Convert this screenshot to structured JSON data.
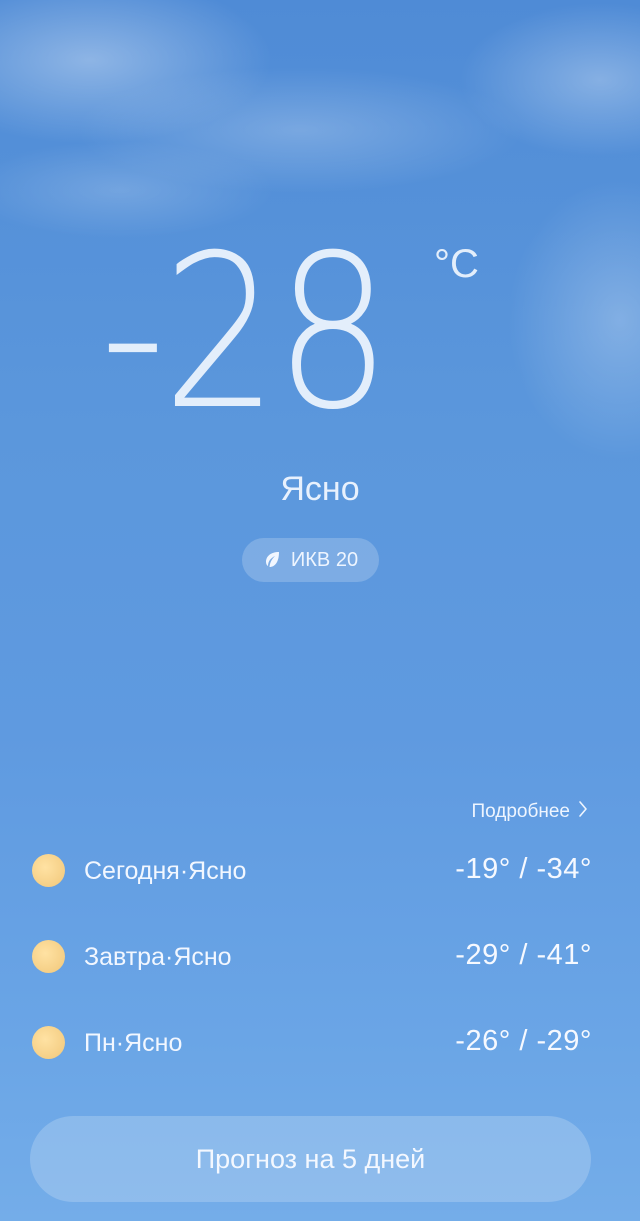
{
  "current": {
    "temperature": "-28",
    "unit": "°C",
    "condition": "Ясно",
    "aqi_label": "ИКВ 20"
  },
  "forecast": {
    "more_label": "Подробнее",
    "days": [
      {
        "label": "Сегодня·Ясно",
        "temps": "-19° / -34°",
        "icon": "sun-icon"
      },
      {
        "label": "Завтра·Ясно",
        "temps": "-29° / -41°",
        "icon": "sun-icon"
      },
      {
        "label": "Пн·Ясно",
        "temps": "-26° / -29°",
        "icon": "sun-icon"
      }
    ],
    "button_label": "Прогноз на 5 дней"
  },
  "colors": {
    "sky_top": "#4f8bd6",
    "sky_bottom": "#74ade9",
    "sun": "#f5cf86"
  }
}
